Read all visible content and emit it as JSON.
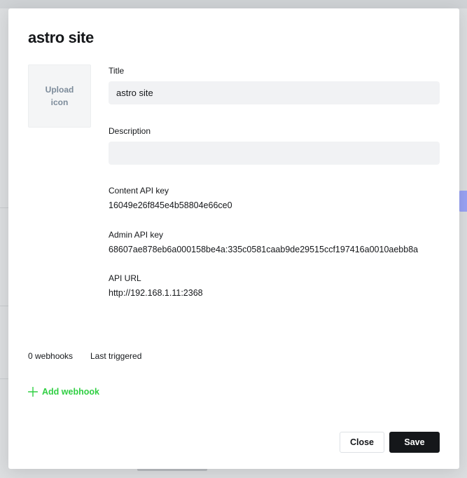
{
  "modal": {
    "title": "astro site"
  },
  "upload": {
    "label": "Upload icon"
  },
  "fields": {
    "title_label": "Title",
    "title_value": "astro site",
    "description_label": "Description",
    "description_value": "",
    "content_api_key_label": "Content API key",
    "content_api_key_value": "16049e26f845e4b58804e66ce0",
    "admin_api_key_label": "Admin API key",
    "admin_api_key_value": "68607ae878eb6a000158be4a:335c0581caab9de29515ccf197416a0010aebb8a",
    "api_url_label": "API URL",
    "api_url_value": "http://192.168.1.11:2368"
  },
  "webhooks": {
    "count_label": "0 webhooks",
    "last_triggered_label": "Last triggered",
    "add_label": "Add webhook",
    "add_icon": "plus-icon",
    "accent_color": "#30cf43"
  },
  "footer": {
    "close_label": "Close",
    "save_label": "Save"
  }
}
